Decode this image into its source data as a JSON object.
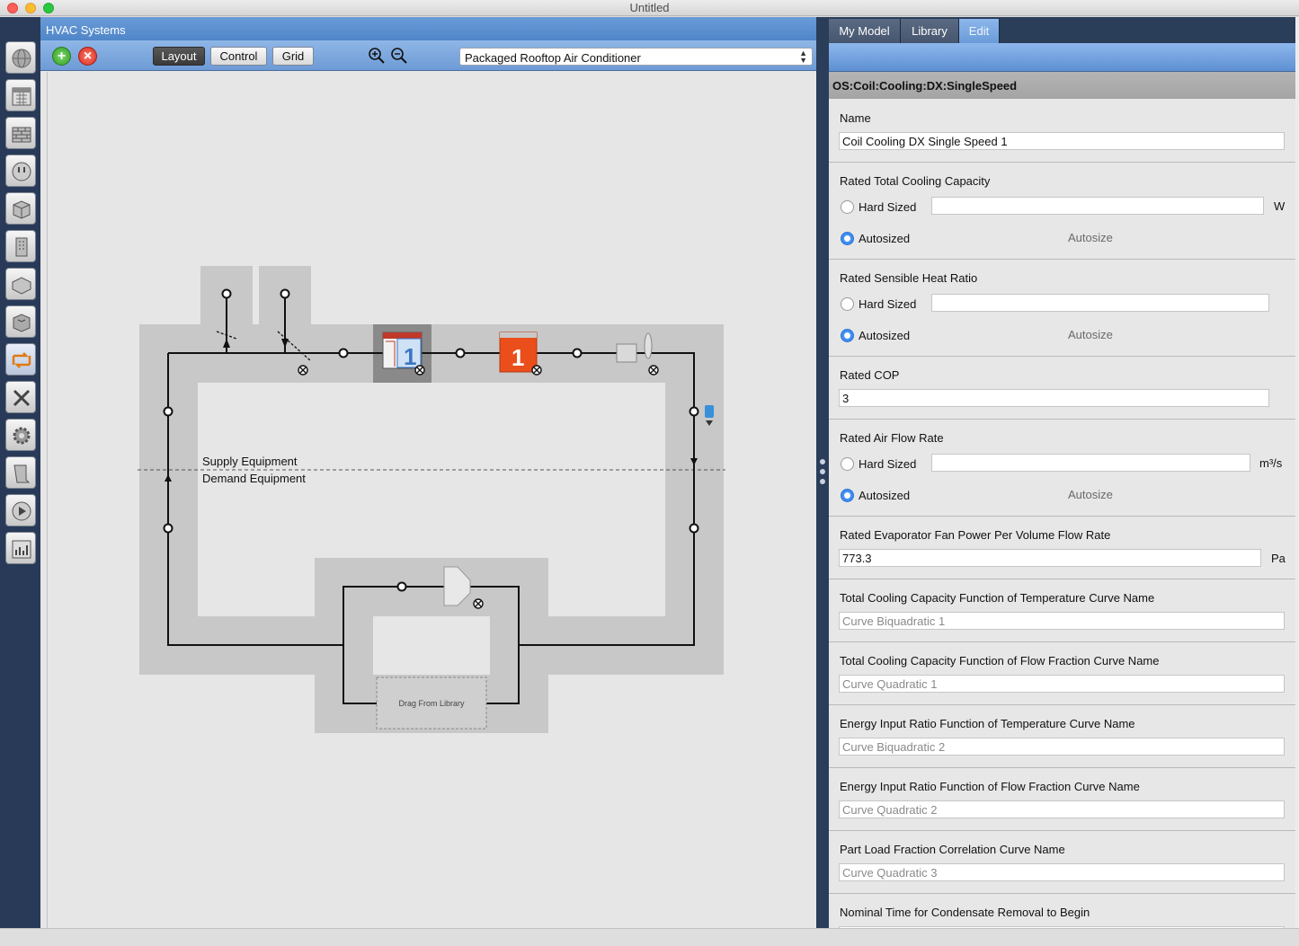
{
  "window": {
    "title": "Untitled"
  },
  "main": {
    "header": "HVAC Systems",
    "toolbar": {
      "add": "+",
      "remove": "×",
      "layout": "Layout",
      "control": "Control",
      "grid": "Grid"
    },
    "system_select": "Packaged Rooftop Air Conditioner",
    "diagram": {
      "supply_label": "Supply Equipment",
      "demand_label": "Demand Equipment",
      "drag_label": "Drag From Library",
      "schedule_number": "1",
      "heating_coil_number": "1"
    }
  },
  "tabs": {
    "my_model": "My Model",
    "library": "Library",
    "edit": "Edit"
  },
  "inspector": {
    "object_type": "OS:Coil:Cooling:DX:SingleSpeed",
    "name": {
      "label": "Name",
      "value": "Coil Cooling DX Single Speed 1"
    },
    "capacity": {
      "label": "Rated Total Cooling Capacity",
      "hard": "Hard Sized",
      "auto": "Autosized",
      "autosize": "Autosize",
      "unit": "W"
    },
    "shr": {
      "label": "Rated Sensible Heat Ratio",
      "hard": "Hard Sized",
      "auto": "Autosized",
      "autosize": "Autosize"
    },
    "cop": {
      "label": "Rated COP",
      "value": "3"
    },
    "airflow": {
      "label": "Rated Air Flow Rate",
      "hard": "Hard Sized",
      "auto": "Autosized",
      "autosize": "Autosize",
      "unit": "m³/s"
    },
    "fanpower": {
      "label": "Rated Evaporator Fan Power Per Volume Flow Rate",
      "value": "773.3",
      "unit": "Pa"
    },
    "tcc_temp": {
      "label": "Total Cooling Capacity Function of Temperature Curve Name",
      "value": "Curve Biquadratic 1"
    },
    "tcc_flow": {
      "label": "Total Cooling Capacity Function of Flow Fraction Curve Name",
      "value": "Curve Quadratic 1"
    },
    "eir_temp": {
      "label": "Energy Input Ratio Function of Temperature Curve Name",
      "value": "Curve Biquadratic 2"
    },
    "eir_flow": {
      "label": "Energy Input Ratio Function of Flow Fraction Curve Name",
      "value": "Curve Quadratic 2"
    },
    "plf": {
      "label": "Part Load Fraction Correlation Curve Name",
      "value": "Curve Quadratic 3"
    },
    "condensate": {
      "label": "Nominal Time for Condensate Removal to Begin"
    }
  },
  "colors": {
    "accent": "#6a9bd8",
    "sidebar": "#283a57",
    "loop_area": "#c8c8c8"
  }
}
